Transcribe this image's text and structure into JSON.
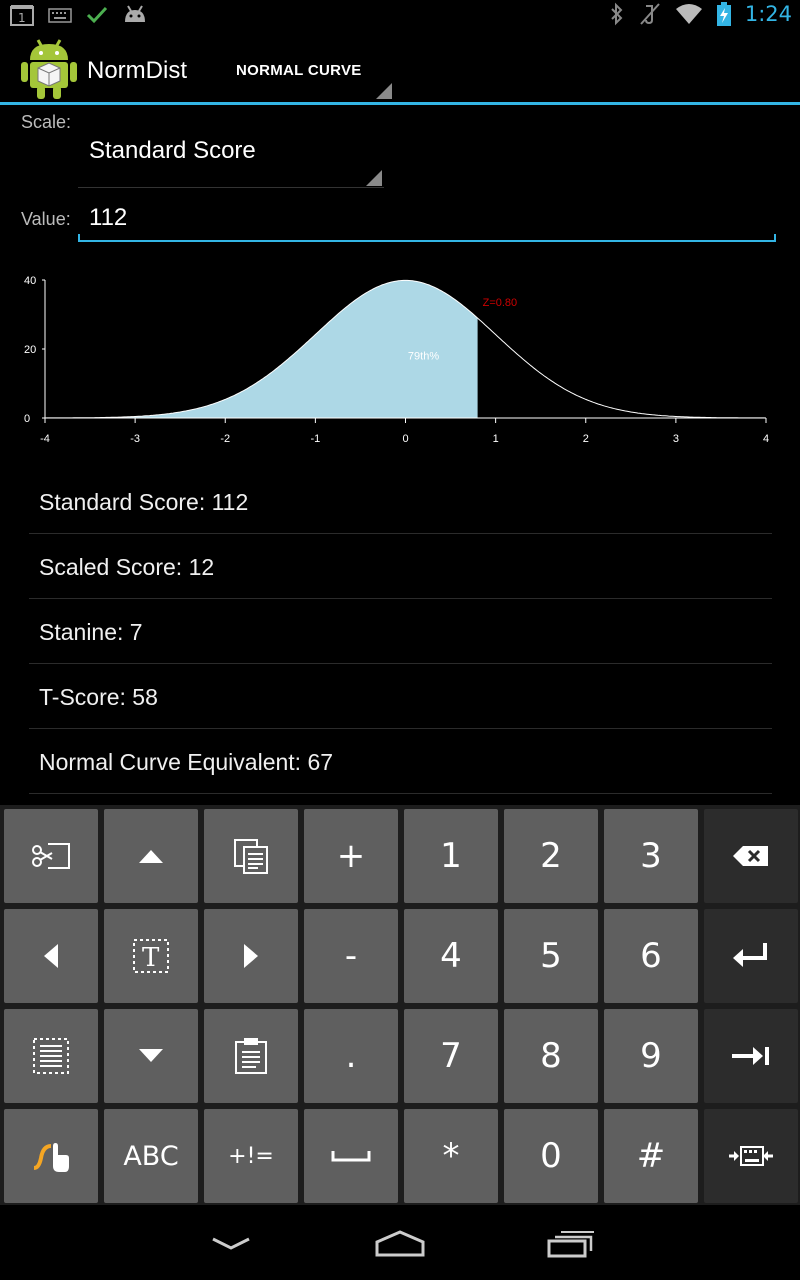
{
  "status_bar": {
    "time": "1:24",
    "left_icons": [
      "notification-1-icon",
      "keyboard-icon",
      "checkmark-icon",
      "android-icon"
    ],
    "right_icons": [
      "bluetooth-icon",
      "muted-icon",
      "wifi-icon",
      "battery-charging-icon"
    ]
  },
  "action_bar": {
    "app_title": "NormDist",
    "nav_selected": "NORMAL CURVE"
  },
  "form": {
    "scale_label": "Scale:",
    "scale_value": "Standard Score",
    "value_label": "Value:",
    "value": "112"
  },
  "chart_data": {
    "type": "area",
    "series": [
      {
        "values": "standard normal density"
      }
    ],
    "x_ticks": [
      "-4",
      "-3",
      "-2",
      "-1",
      "0",
      "1",
      "2",
      "3",
      "4"
    ],
    "y_ticks": [
      "40",
      "20",
      "0"
    ],
    "xlim": [
      -4,
      4
    ],
    "ylim": [
      0,
      40
    ],
    "shaded_to_z": 0.8,
    "shaded_label": "79th%",
    "z_label": "Z=0.80",
    "colors": {
      "shade": "#add8e6",
      "curve": "#ffffff",
      "z_label": "#cc0000",
      "axis": "#ffffff"
    }
  },
  "results": [
    "Standard Score: 112",
    "Scaled Score: 12",
    "Stanine: 7",
    "T-Score: 58",
    "Normal Curve Equivalent: 67"
  ],
  "keyboard": {
    "row1": [
      {
        "name": "select-all-icon",
        "label": ""
      },
      {
        "name": "up-arrow-icon",
        "label": ""
      },
      {
        "name": "copy-icon",
        "label": ""
      },
      {
        "name": "plus-key",
        "label": "+"
      },
      {
        "name": "digit-1-key",
        "label": "1"
      },
      {
        "name": "digit-2-key",
        "label": "2"
      },
      {
        "name": "digit-3-key",
        "label": "3"
      },
      {
        "name": "backspace-icon",
        "label": ""
      }
    ],
    "row2": [
      {
        "name": "left-arrow-icon",
        "label": ""
      },
      {
        "name": "text-cursor-icon",
        "label": ""
      },
      {
        "name": "right-arrow-icon",
        "label": ""
      },
      {
        "name": "minus-key",
        "label": "-"
      },
      {
        "name": "digit-4-key",
        "label": "4"
      },
      {
        "name": "digit-5-key",
        "label": "5"
      },
      {
        "name": "digit-6-key",
        "label": "6"
      },
      {
        "name": "enter-icon",
        "label": ""
      }
    ],
    "row3": [
      {
        "name": "select-text-icon",
        "label": ""
      },
      {
        "name": "down-arrow-icon",
        "label": ""
      },
      {
        "name": "paste-icon",
        "label": ""
      },
      {
        "name": "period-key",
        "label": "."
      },
      {
        "name": "digit-7-key",
        "label": "7"
      },
      {
        "name": "digit-8-key",
        "label": "8"
      },
      {
        "name": "digit-9-key",
        "label": "9"
      },
      {
        "name": "tab-icon",
        "label": ""
      }
    ],
    "row4": [
      {
        "name": "swype-icon",
        "label": ""
      },
      {
        "name": "abc-key",
        "label": "ABC"
      },
      {
        "name": "symbols-key",
        "label": "+!="
      },
      {
        "name": "space-icon",
        "label": ""
      },
      {
        "name": "asterisk-key",
        "label": "*"
      },
      {
        "name": "digit-0-key",
        "label": "0"
      },
      {
        "name": "hash-key",
        "label": "#"
      },
      {
        "name": "keyboard-hide-icon",
        "label": ""
      }
    ]
  },
  "nav_bar": {
    "buttons": [
      "back-icon",
      "home-icon",
      "recent-apps-icon"
    ]
  }
}
